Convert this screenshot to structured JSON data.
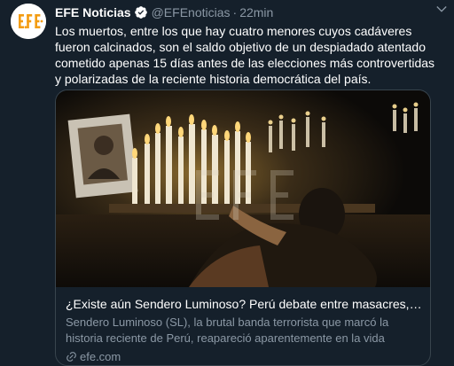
{
  "tweet": {
    "display_name": "EFE Noticias",
    "handle": "@EFEnoticias",
    "separator": "·",
    "time": "22min",
    "avatar_text": "EFE",
    "text": "Los muertos, entre los que hay cuatro menores cuyos cadáveres fueron calcinados, son el saldo objetivo de un despiadado atentado cometido apenas 15 días antes de las elecciones más controvertidas y polarizadas de la reciente historia democrática del país.",
    "card": {
      "title": "¿Existe aún Sendero Luminoso? Perú debate entre masacres, drogas…",
      "description": "Sendero Luminoso (SL), la brutal banda terrorista que marcó la historia reciente de Perú, reapareció aparentemente en la vida política del paí…",
      "domain": "efe.com",
      "photo_watermark": "EFE"
    }
  },
  "icons": {
    "verified": "verified-badge-icon",
    "link": "link-icon",
    "more": "chevron-down-icon"
  },
  "colors": {
    "background": "#15202b",
    "secondary_text": "#8b98a5",
    "border": "#38444d",
    "brand_orange": "#f39c12"
  }
}
